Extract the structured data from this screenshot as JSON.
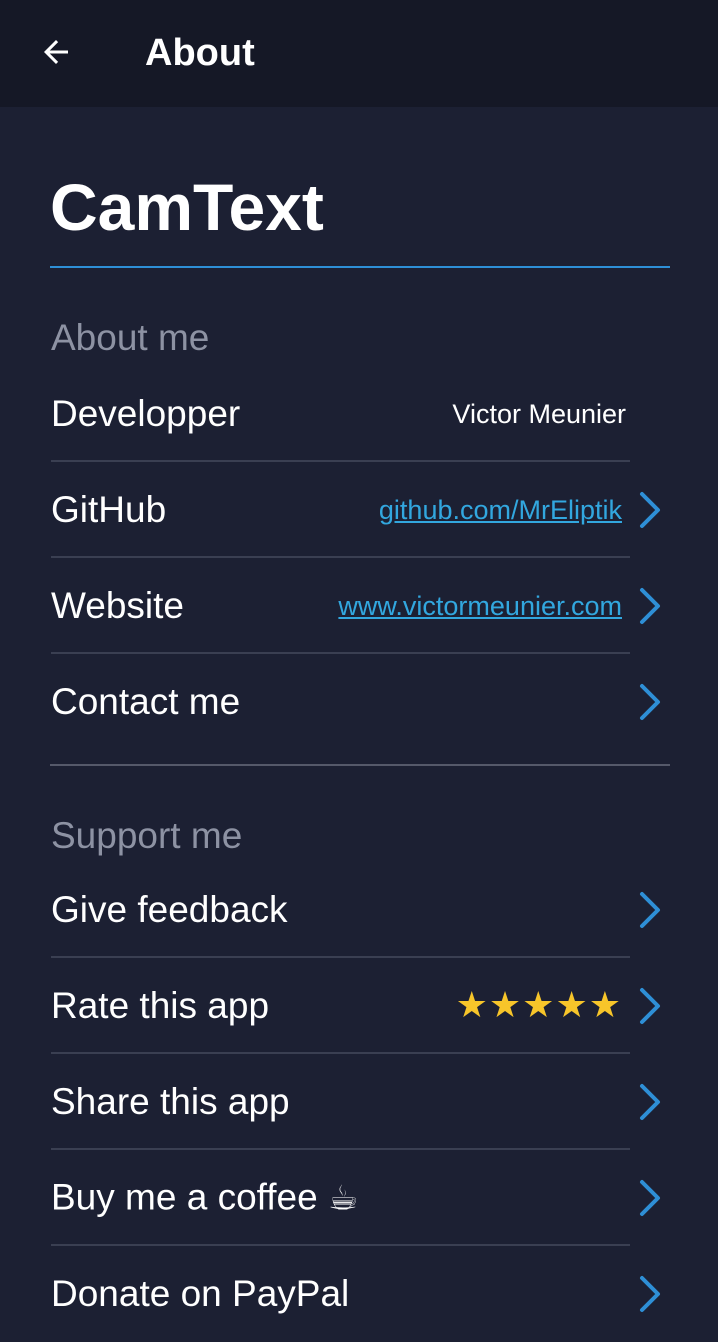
{
  "topbar": {
    "title": "About",
    "back_icon": "arrow-left-icon"
  },
  "app": {
    "name": "CamText"
  },
  "about_section": {
    "header": "About me",
    "rows": [
      {
        "label": "Developper",
        "value": "Victor Meunier"
      },
      {
        "label": "GitHub",
        "value": "github.com/MrEliptik"
      },
      {
        "label": "Website",
        "value": "www.victormeunier.com"
      },
      {
        "label": "Contact me",
        "value": ""
      }
    ]
  },
  "support_section": {
    "header": "Support me",
    "rows": [
      {
        "label": "Give feedback"
      },
      {
        "label": "Rate this app",
        "stars": "★★★★★",
        "rating": 5,
        "rating_max": 5
      },
      {
        "label": "Share this app"
      },
      {
        "label": "Buy me a coffee",
        "emoji": "☕"
      },
      {
        "label": "Donate on PayPal"
      }
    ]
  },
  "colors": {
    "background": "#1c2033",
    "topbar": "#151826",
    "accent": "#2e8fd6",
    "link": "#32a7df",
    "muted": "#8d92a3",
    "star": "#f7c52a"
  }
}
